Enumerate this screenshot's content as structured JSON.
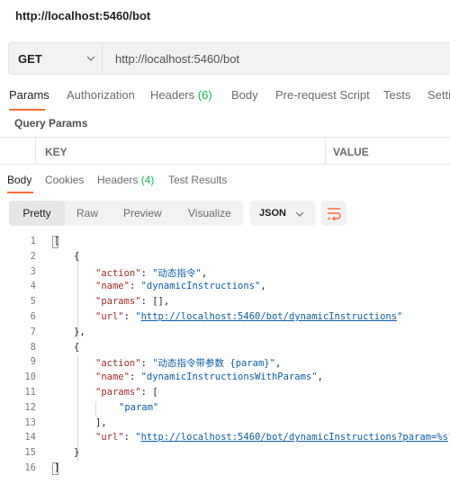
{
  "window": {
    "title": "http://localhost:5460/bot"
  },
  "request": {
    "method": "GET",
    "url": "http://localhost:5460/bot",
    "icons": {
      "method_dropdown": "chevron-down-icon"
    }
  },
  "request_tabs": {
    "params": "Params",
    "authorization": "Authorization",
    "headers": "Headers",
    "headers_count": "(6)",
    "body": "Body",
    "prerequest": "Pre-request Script",
    "tests": "Tests",
    "settings": "Setti"
  },
  "query_params": {
    "title": "Query Params",
    "columns": {
      "key": "KEY",
      "value": "VALUE"
    }
  },
  "response_tabs": {
    "body": "Body",
    "cookies": "Cookies",
    "headers": "Headers",
    "headers_count": "(4)",
    "test_results": "Test Results"
  },
  "format_bar": {
    "pretty": "Pretty",
    "raw": "Raw",
    "preview": "Preview",
    "visualize": "Visualize",
    "language": "JSON",
    "icons": {
      "language_dropdown": "chevron-down-icon",
      "wrap": "wrap-lines-icon"
    }
  },
  "colors": {
    "accent": "#ff6c37",
    "count": "#0cbb52",
    "key": "#a42a2a",
    "string": "#0a5ea8"
  },
  "code": {
    "line_numbers": [
      "1",
      "2",
      "3",
      "4",
      "5",
      "6",
      "7",
      "8",
      "9",
      "10",
      "11",
      "12",
      "13",
      "14",
      "15",
      "16"
    ],
    "l1": "[",
    "l2": "{",
    "l3": {
      "key": "\"action\"",
      "colon": ": ",
      "value": "\"动态指令\"",
      "end": ","
    },
    "l4": {
      "key": "\"name\"",
      "colon": ": ",
      "value": "\"dynamicInstructions\"",
      "end": ","
    },
    "l5": {
      "key": "\"params\"",
      "rest": ": [],",
      "colon": ": [],",
      "value": ""
    },
    "l6": {
      "key": "\"url\"",
      "colon": ": ",
      "q1": "\"",
      "link": "http://localhost:5460/bot/dynamicInstructions",
      "q2": "\""
    },
    "l7": "},",
    "l8": "{",
    "l9": {
      "key": "\"action\"",
      "colon": ": ",
      "value": "\"动态指令带参数 {param}\"",
      "end": ","
    },
    "l10": {
      "key": "\"name\"",
      "colon": ": ",
      "value": "\"dynamicInstructionsWithParams\"",
      "end": ","
    },
    "l11": {
      "key": "\"params\"",
      "colon": ": ["
    },
    "l12": "\"param\"",
    "l13": "],",
    "l14": {
      "key": "\"url\"",
      "colon": ": ",
      "q1": "\"",
      "link": "http://localhost:5460/bot/dynamicInstructions?param=%s",
      "q2": "\""
    },
    "l15": "}",
    "l16": "]"
  }
}
